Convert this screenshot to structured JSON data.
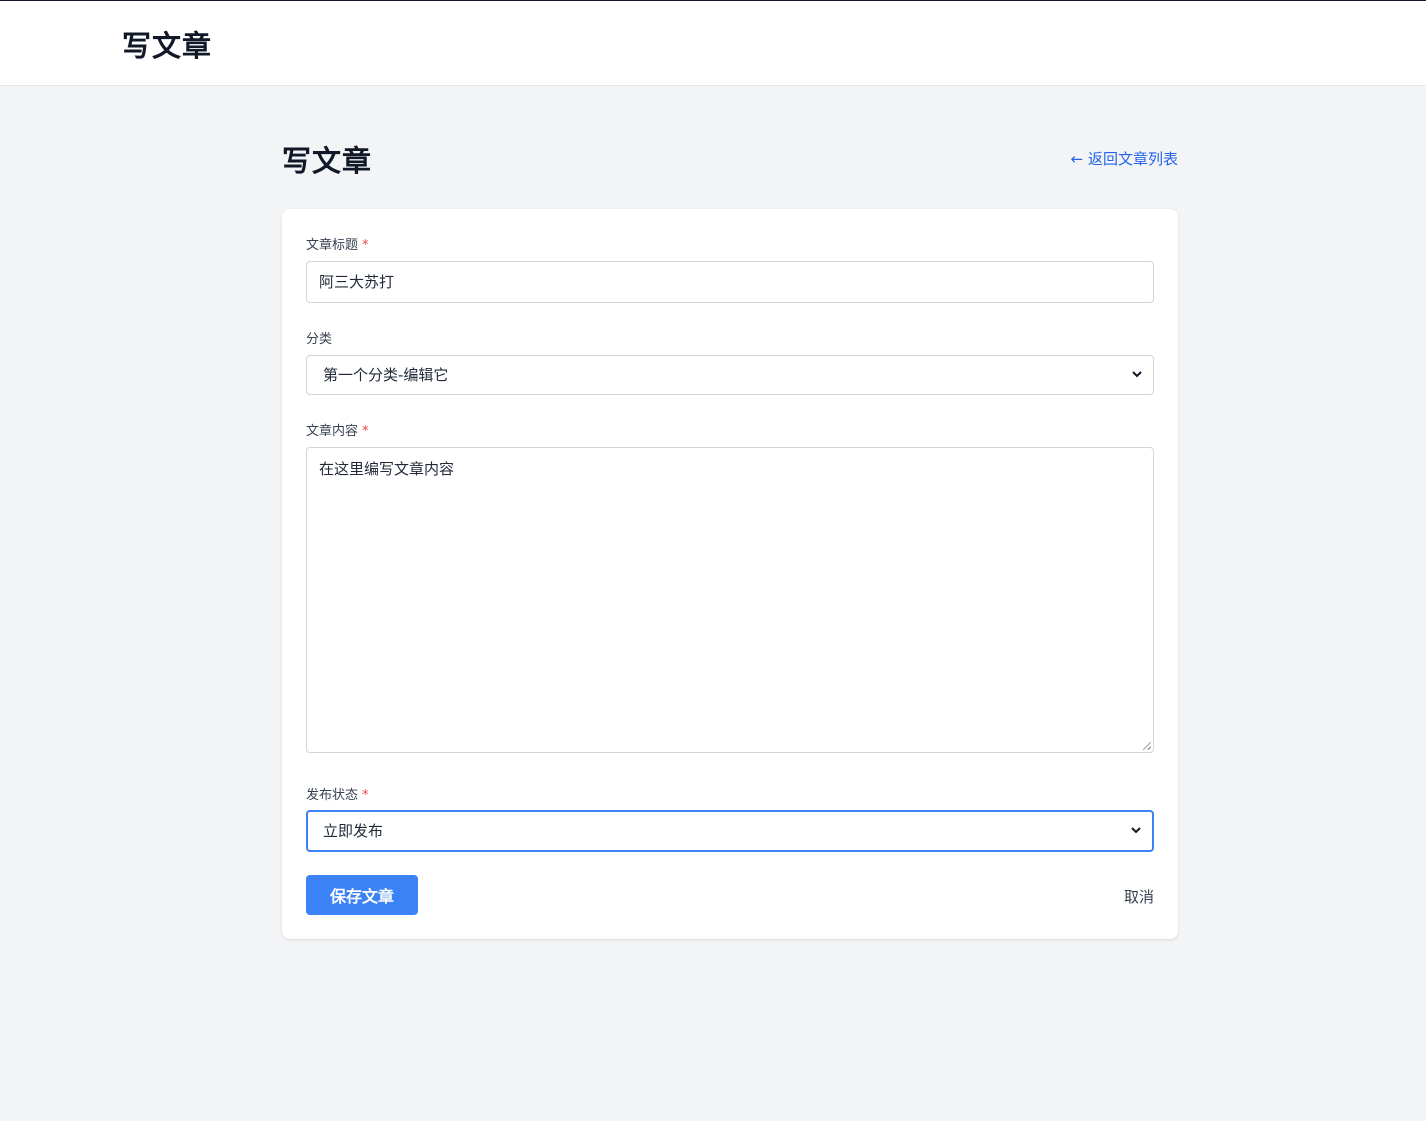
{
  "header": {
    "title": "写文章"
  },
  "page": {
    "title": "写文章",
    "back_link": "← 返回文章列表"
  },
  "form": {
    "title_field": {
      "label": "文章标题",
      "required_mark": "*",
      "value": "阿三大苏打"
    },
    "category_field": {
      "label": "分类",
      "selected": "第一个分类-编辑它"
    },
    "content_field": {
      "label": "文章内容",
      "required_mark": "*",
      "value": "在这里编写文章内容"
    },
    "status_field": {
      "label": "发布状态",
      "required_mark": "*",
      "selected": "立即发布"
    },
    "save_label": "保存文章",
    "cancel_label": "取消"
  },
  "colors": {
    "primary": "#3b82f6",
    "link": "#2563eb",
    "required": "#ef4444",
    "background": "#f3f4f6"
  }
}
